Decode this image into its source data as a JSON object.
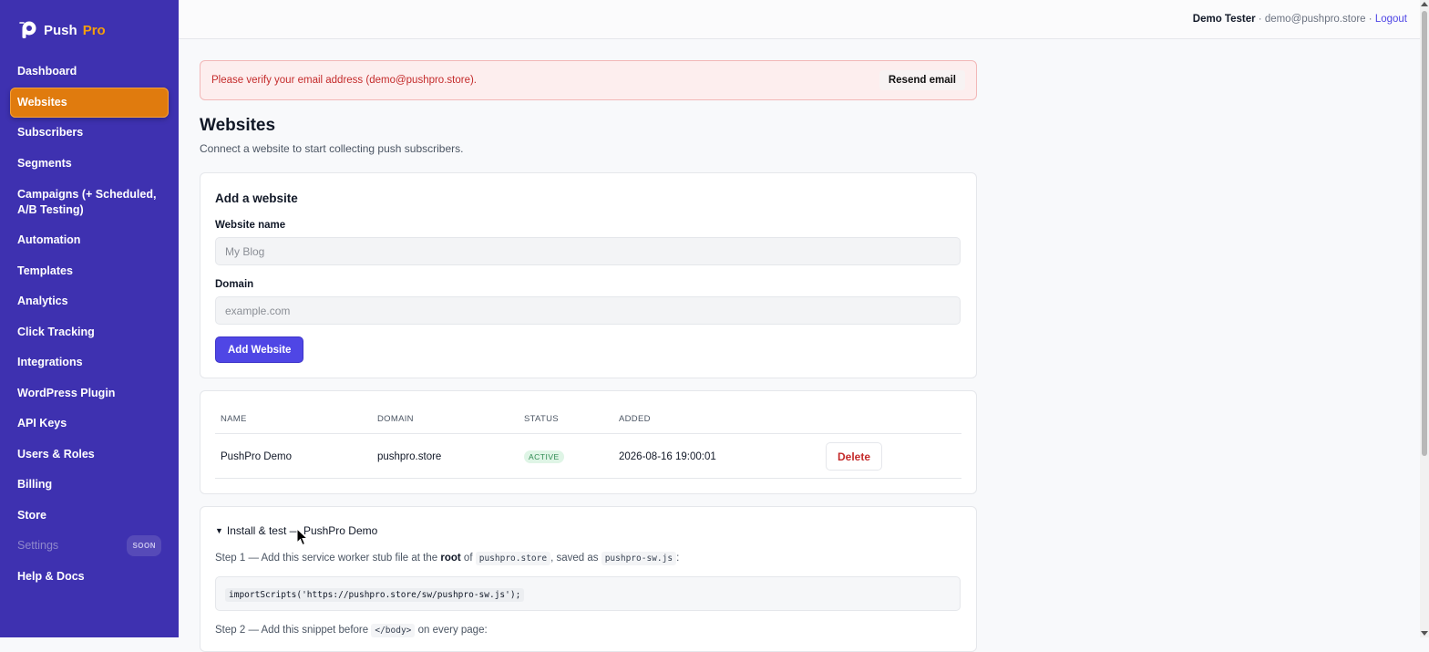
{
  "brand": {
    "push": "Push",
    "pro": "Pro"
  },
  "colors": {
    "sidebar": "#3e31b0",
    "active": "#e07b0e",
    "primary": "#4f46e5",
    "danger": "#c42b2b"
  },
  "sidebar": {
    "items": [
      {
        "label": "Dashboard"
      },
      {
        "label": "Websites",
        "active": true
      },
      {
        "label": "Subscribers"
      },
      {
        "label": "Segments"
      },
      {
        "label": "Campaigns (+ Scheduled, A/B Testing)"
      },
      {
        "label": "Automation"
      },
      {
        "label": "Templates"
      },
      {
        "label": "Analytics"
      },
      {
        "label": "Click Tracking"
      },
      {
        "label": "Integrations"
      },
      {
        "label": "WordPress Plugin"
      },
      {
        "label": "API Keys"
      },
      {
        "label": "Users & Roles"
      },
      {
        "label": "Billing"
      },
      {
        "label": "Store"
      },
      {
        "label": "Settings",
        "badge": "SOON",
        "disabled": true
      },
      {
        "label": "Help & Docs"
      }
    ]
  },
  "topbar": {
    "user_name": "Demo Tester",
    "separator1": " · ",
    "email": "demo@pushpro.store",
    "separator2": " · ",
    "logout": "Logout"
  },
  "alert": {
    "message": "Please verify your email address (demo@pushpro.store).",
    "button": "Resend email"
  },
  "page": {
    "title": "Websites",
    "subtitle": "Connect a website to start collecting push subscribers."
  },
  "add_form": {
    "title": "Add a website",
    "name_label": "Website name",
    "name_placeholder": "My Blog",
    "domain_label": "Domain",
    "domain_placeholder": "example.com",
    "submit": "Add Website"
  },
  "table": {
    "headers": {
      "name": "NAME",
      "domain": "DOMAIN",
      "status": "STATUS",
      "added": "ADDED"
    },
    "rows": [
      {
        "name": "PushPro Demo",
        "domain": "pushpro.store",
        "status": "ACTIVE",
        "added": "2026-08-16 19:00:01",
        "action": "Delete"
      }
    ]
  },
  "install": {
    "summary": "Install & test — PushPro Demo",
    "step1": {
      "prefix": "Step 1 — Add this service worker stub file at the ",
      "bold": "root",
      "mid1": " of ",
      "domain": "pushpro.store",
      "mid2": ", saved as ",
      "file": "pushpro-sw.js",
      "suffix": ":"
    },
    "code": "importScripts('https://pushpro.store/sw/pushpro-sw.js');",
    "step2": {
      "prefix": "Step 2 — Add this snippet before ",
      "tag": "</body>",
      "suffix": " on every page:"
    }
  }
}
